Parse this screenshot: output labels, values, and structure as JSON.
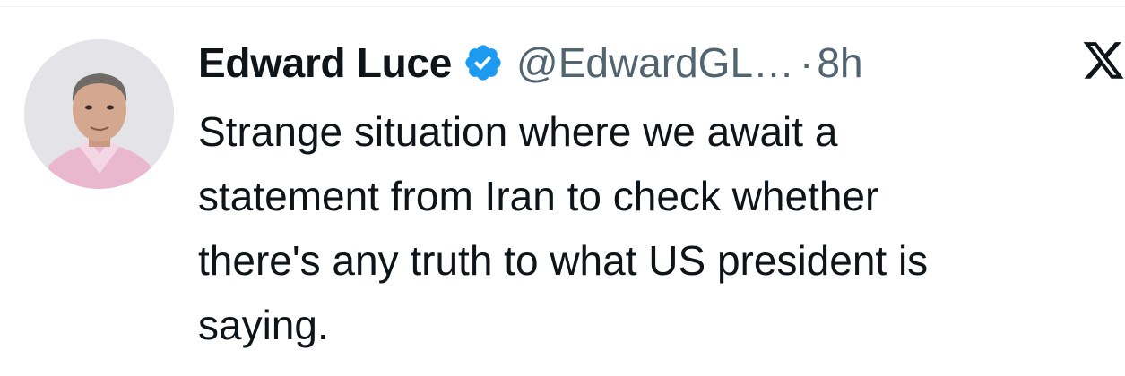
{
  "tweet": {
    "author_name": "Edward Luce",
    "handle": "@EdwardGL…",
    "separator": "·",
    "time": "8h",
    "text_lines": [
      "Strange situation where we await a",
      "statement from Iran to check whether",
      "there's any truth to what US president is",
      "saying."
    ],
    "verified_icon": "verified-badge-icon",
    "platform_icon": "x-logo-icon"
  },
  "colors": {
    "text_primary": "#0f1419",
    "text_secondary": "#536471",
    "verified_blue": "#1d9bf0",
    "divider": "#eff3f4"
  }
}
